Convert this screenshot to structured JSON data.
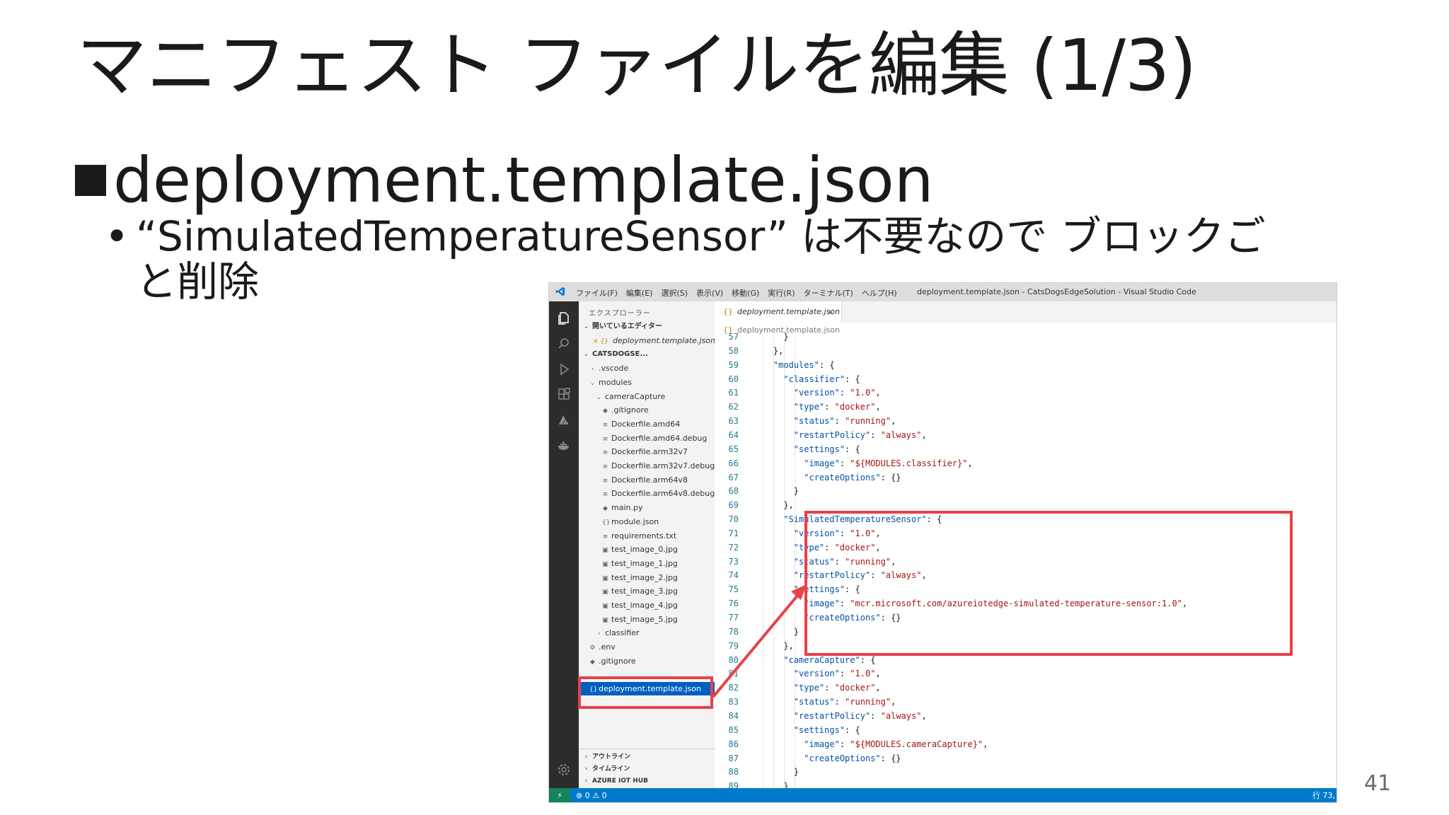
{
  "slide": {
    "title": "マニフェスト ファイルを編集 (1/3)",
    "bullet_main": "deployment.template.json",
    "bullet_dot": "•",
    "bullet_sub": "“SimulatedTemperatureSensor” は不要なので ブロックごと削除",
    "page_number": "41"
  },
  "vscode": {
    "menu": [
      "ファイル(F)",
      "編集(E)",
      "選択(S)",
      "表示(V)",
      "移動(G)",
      "実行(R)",
      "ターミナル(T)",
      "ヘルプ(H)"
    ],
    "window_title": "deployment.template.json - CatsDogsEdgeSolution - Visual Studio Code",
    "explorer_title": "エクスプローラー",
    "explorer": [
      {
        "label": "開いているエディター",
        "icon": "⌄",
        "kind": "section"
      },
      {
        "label": "deployment.template.json",
        "icon": "×  {}",
        "kind": "open-editor"
      },
      {
        "label": "CATSDOGSE...",
        "icon": "⌄",
        "kind": "section"
      },
      {
        "label": ".vscode",
        "icon": "›",
        "kind": "folder",
        "depth": 1
      },
      {
        "label": "modules",
        "icon": "⌄",
        "kind": "folder",
        "depth": 1
      },
      {
        "label": "cameraCapture",
        "icon": "⌄",
        "kind": "folder",
        "depth": 2
      },
      {
        "label": ".gitignore",
        "icon": "◆",
        "kind": "file",
        "depth": 3
      },
      {
        "label": "Dockerfile.amd64",
        "icon": "≡",
        "kind": "file",
        "depth": 3
      },
      {
        "label": "Dockerfile.amd64.debug",
        "icon": "≡",
        "kind": "file",
        "depth": 3
      },
      {
        "label": "Dockerfile.arm32v7",
        "icon": "≡",
        "kind": "file",
        "depth": 3
      },
      {
        "label": "Dockerfile.arm32v7.debug",
        "icon": "≡",
        "kind": "file",
        "depth": 3
      },
      {
        "label": "Dockerfile.arm64v8",
        "icon": "≡",
        "kind": "file",
        "depth": 3
      },
      {
        "label": "Dockerfile.arm64v8.debug",
        "icon": "≡",
        "kind": "file",
        "depth": 3
      },
      {
        "label": "main.py",
        "icon": "◆",
        "kind": "file",
        "depth": 3
      },
      {
        "label": "module.json",
        "icon": "{}",
        "kind": "file",
        "depth": 3
      },
      {
        "label": "requirements.txt",
        "icon": "≡",
        "kind": "file",
        "depth": 3
      },
      {
        "label": "test_image_0.jpg",
        "icon": "▣",
        "kind": "file",
        "depth": 3
      },
      {
        "label": "test_image_1.jpg",
        "icon": "▣",
        "kind": "file",
        "depth": 3
      },
      {
        "label": "test_image_2.jpg",
        "icon": "▣",
        "kind": "file",
        "depth": 3
      },
      {
        "label": "test_image_3.jpg",
        "icon": "▣",
        "kind": "file",
        "depth": 3
      },
      {
        "label": "test_image_4.jpg",
        "icon": "▣",
        "kind": "file",
        "depth": 3
      },
      {
        "label": "test_image_5.jpg",
        "icon": "▣",
        "kind": "file",
        "depth": 3
      },
      {
        "label": "classifier",
        "icon": "›",
        "kind": "folder",
        "depth": 2
      },
      {
        "label": ".env",
        "icon": "⚙",
        "kind": "file",
        "depth": 1
      },
      {
        "label": ".gitignore",
        "icon": "◆",
        "kind": "file",
        "depth": 1
      },
      {
        "label": "",
        "icon": "",
        "kind": "spacer",
        "depth": 1
      },
      {
        "label": "deployment.template.json",
        "icon": "{}",
        "kind": "selected",
        "depth": 1
      }
    ],
    "bottom_sections": [
      "アウトライン",
      "タイムライン",
      "AZURE IOT HUB"
    ],
    "tab_label": "deployment.template.json",
    "breadcrumb": "deployment.template.json",
    "code": [
      {
        "n": "57",
        "t": "      }"
      },
      {
        "n": "58",
        "t": "    },"
      },
      {
        "n": "59",
        "t": "    \"modules\": {"
      },
      {
        "n": "60",
        "t": "      \"classifier\": {"
      },
      {
        "n": "61",
        "t": "        \"version\": \"1.0\","
      },
      {
        "n": "62",
        "t": "        \"type\": \"docker\","
      },
      {
        "n": "63",
        "t": "        \"status\": \"running\","
      },
      {
        "n": "64",
        "t": "        \"restartPolicy\": \"always\","
      },
      {
        "n": "65",
        "t": "        \"settings\": {"
      },
      {
        "n": "66",
        "t": "          \"image\": \"${MODULES.classifier}\","
      },
      {
        "n": "67",
        "t": "          \"createOptions\": {}"
      },
      {
        "n": "68",
        "t": "        }"
      },
      {
        "n": "69",
        "t": "      },"
      },
      {
        "n": "70",
        "t": "      \"SimulatedTemperatureSensor\": {"
      },
      {
        "n": "71",
        "t": "        \"version\": \"1.0\","
      },
      {
        "n": "72",
        "t": "        \"type\": \"docker\","
      },
      {
        "n": "73",
        "t": "        \"status\": \"running\","
      },
      {
        "n": "74",
        "t": "        \"restartPolicy\": \"always\","
      },
      {
        "n": "75",
        "t": "        \"settings\": {"
      },
      {
        "n": "76",
        "t": "          \"image\": \"mcr.microsoft.com/azureiotedge-simulated-temperature-sensor:1.0\","
      },
      {
        "n": "77",
        "t": "          \"createOptions\": {}"
      },
      {
        "n": "78",
        "t": "        }"
      },
      {
        "n": "79",
        "t": "      },"
      },
      {
        "n": "80",
        "t": "      \"cameraCapture\": {"
      },
      {
        "n": "81",
        "t": "        \"version\": \"1.0\","
      },
      {
        "n": "82",
        "t": "        \"type\": \"docker\","
      },
      {
        "n": "83",
        "t": "        \"status\": \"running\","
      },
      {
        "n": "84",
        "t": "        \"restartPolicy\": \"always\","
      },
      {
        "n": "85",
        "t": "        \"settings\": {"
      },
      {
        "n": "86",
        "t": "          \"image\": \"${MODULES.cameraCapture}\","
      },
      {
        "n": "87",
        "t": "          \"createOptions\": {}"
      },
      {
        "n": "88",
        "t": "        }"
      },
      {
        "n": "89",
        "t": "      }"
      }
    ],
    "status": {
      "remote": "⚡",
      "problems": "⊗ 0 ⚠ 0",
      "position": "行 73,"
    }
  },
  "colors": {
    "accent_red": "#e8414a",
    "statusbar_blue": "#007acc",
    "selection_blue": "#0060c0",
    "activitybar": "#2c2c2c"
  }
}
